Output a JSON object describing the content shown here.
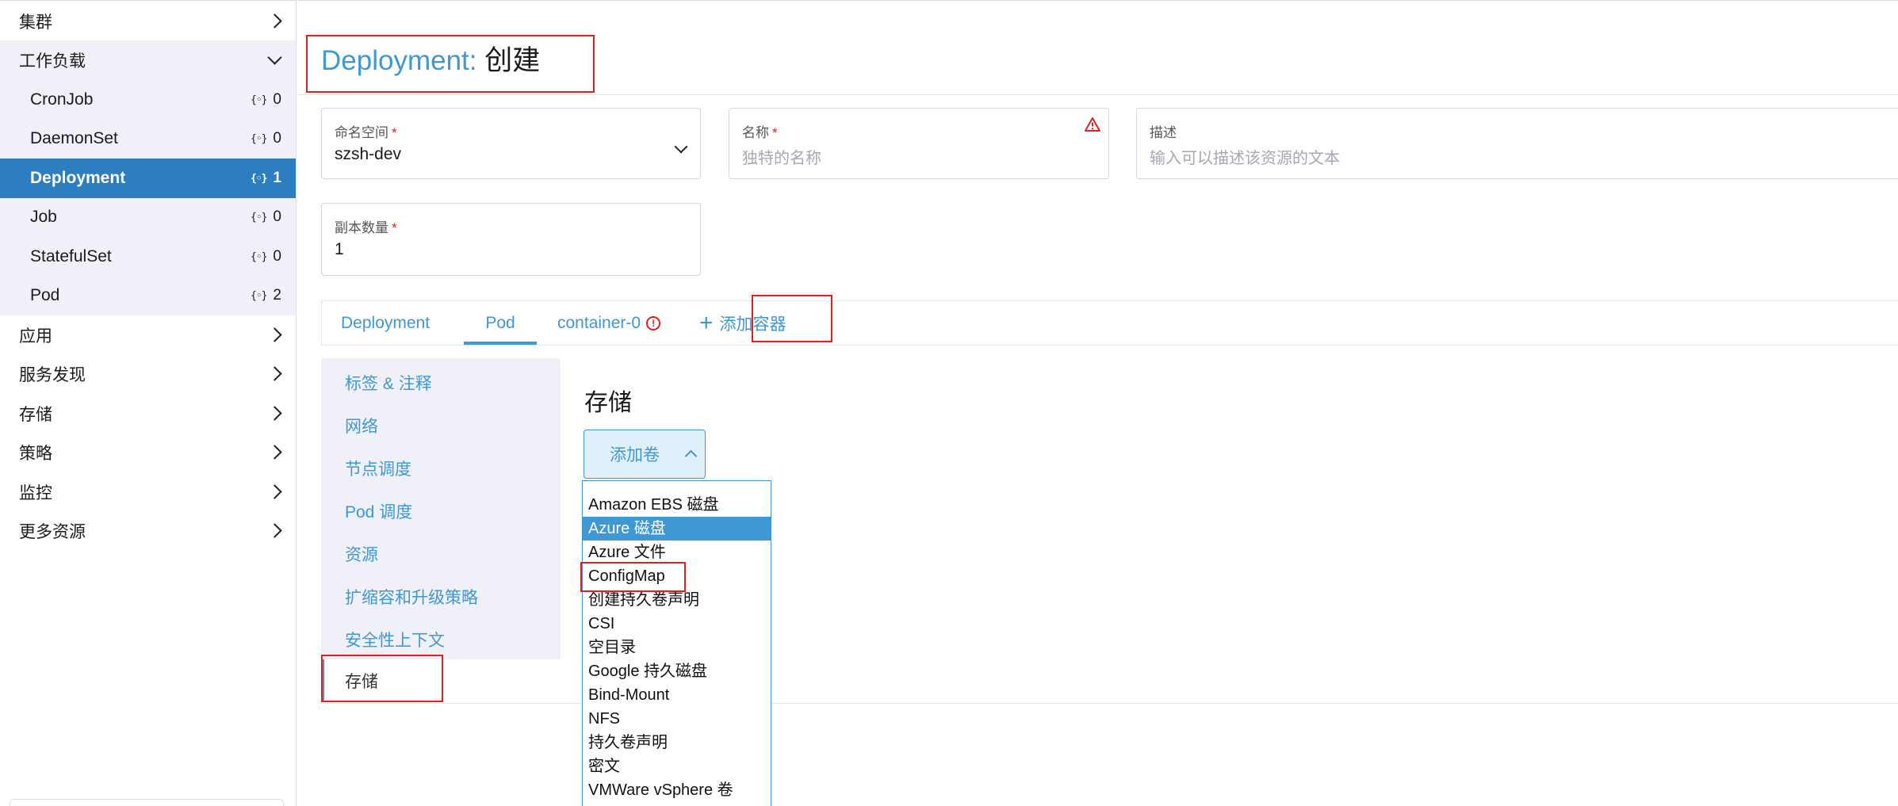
{
  "sidebar": {
    "groups": [
      {
        "label": "集群"
      },
      {
        "label": "工作负载"
      },
      {
        "label": "应用"
      },
      {
        "label": "服务发现"
      },
      {
        "label": "存储"
      },
      {
        "label": "策略"
      },
      {
        "label": "监控"
      },
      {
        "label": "更多资源"
      }
    ],
    "workloads": [
      {
        "label": "CronJob",
        "count": "0"
      },
      {
        "label": "DaemonSet",
        "count": "0"
      },
      {
        "label": "Deployment",
        "count": "1"
      },
      {
        "label": "Job",
        "count": "0"
      },
      {
        "label": "StatefulSet",
        "count": "0"
      },
      {
        "label": "Pod",
        "count": "2"
      }
    ],
    "count_icon": "{◦}"
  },
  "header": {
    "resource": "Deployment:",
    "action": "创建"
  },
  "form": {
    "namespace": {
      "label": "命名空间",
      "required": "*",
      "value": "szsh-dev"
    },
    "name": {
      "label": "名称",
      "required": "*",
      "placeholder": "独特的名称"
    },
    "description": {
      "label": "描述",
      "placeholder": "输入可以描述该资源的文本"
    },
    "replicas": {
      "label": "副本数量",
      "required": "*",
      "value": "1"
    }
  },
  "tabs": {
    "deployment": "Deployment",
    "pod": "Pod",
    "container": "container-0",
    "add_container": "添加容器",
    "error_mark": "!"
  },
  "inner_nav": [
    {
      "label": "标签 & 注释"
    },
    {
      "label": "网络"
    },
    {
      "label": "节点调度"
    },
    {
      "label": "Pod 调度"
    },
    {
      "label": "资源"
    },
    {
      "label": "扩缩容和升级策略"
    },
    {
      "label": "安全性上下文"
    },
    {
      "label": "存储"
    }
  ],
  "storage": {
    "title": "存储",
    "add_volume": "添加卷",
    "options": [
      "Amazon EBS 磁盘",
      "Azure 磁盘",
      "Azure 文件",
      "ConfigMap",
      "创建持久卷声明",
      "CSI",
      "空目录",
      "Google 持久磁盘",
      "Bind-Mount",
      "NFS",
      "持久卷声明",
      "密文",
      "VMWare vSphere 卷"
    ],
    "highlighted_option": "Azure 磁盘"
  },
  "colors": {
    "accent": "#3d98d3",
    "active_nav": "#2d7ec1",
    "annotation_box": "#e02020",
    "nav_bg": "#f0f1f8"
  }
}
